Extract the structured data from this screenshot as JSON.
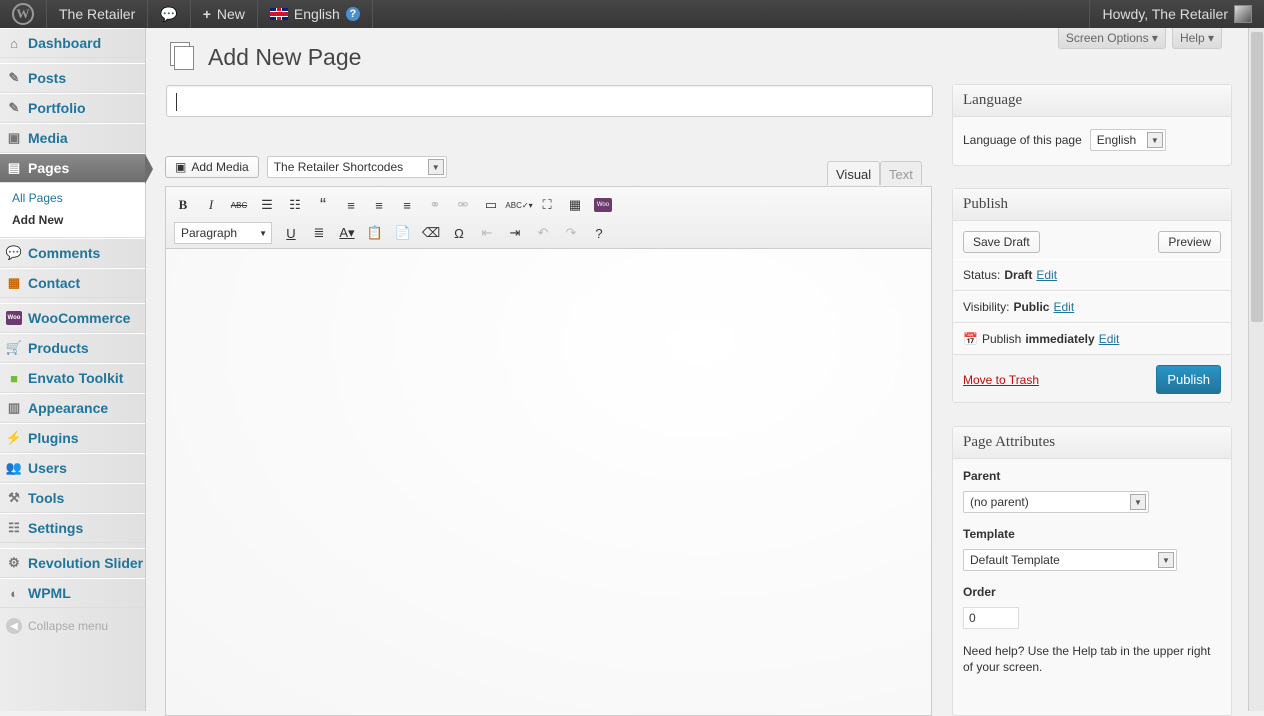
{
  "adminbar": {
    "site": "The Retailer",
    "new": "New",
    "language": "English",
    "howdy": "Howdy, The Retailer"
  },
  "menu": {
    "dashboard": "Dashboard",
    "posts": "Posts",
    "portfolio": "Portfolio",
    "media": "Media",
    "pages": "Pages",
    "all_pages": "All Pages",
    "add_new": "Add New",
    "comments": "Comments",
    "contact": "Contact",
    "woocommerce": "WooCommerce",
    "products": "Products",
    "envato": "Envato Toolkit",
    "appearance": "Appearance",
    "plugins": "Plugins",
    "users": "Users",
    "tools": "Tools",
    "settings": "Settings",
    "revslider": "Revolution Slider",
    "wpml": "WPML",
    "collapse": "Collapse menu"
  },
  "top": {
    "screen_options": "Screen Options",
    "help": "Help"
  },
  "page": {
    "title": "Add New Page",
    "title_value": ""
  },
  "editor": {
    "add_media": "Add Media",
    "shortcodes": "The Retailer Shortcodes",
    "visual": "Visual",
    "text": "Text",
    "format": "Paragraph"
  },
  "language_box": {
    "title": "Language",
    "label": "Language of this page",
    "value": "English"
  },
  "publish": {
    "title": "Publish",
    "save_draft": "Save Draft",
    "preview": "Preview",
    "status_label": "Status:",
    "status": "Draft",
    "visibility_label": "Visibility:",
    "visibility": "Public",
    "publish_label": "Publish",
    "publish_when": "immediately",
    "edit": "Edit",
    "trash": "Move to Trash",
    "publish_btn": "Publish"
  },
  "attributes": {
    "title": "Page Attributes",
    "parent_label": "Parent",
    "parent": "(no parent)",
    "template_label": "Template",
    "template": "Default Template",
    "order_label": "Order",
    "order": "0",
    "help": "Need help? Use the Help tab in the upper right of your screen."
  }
}
